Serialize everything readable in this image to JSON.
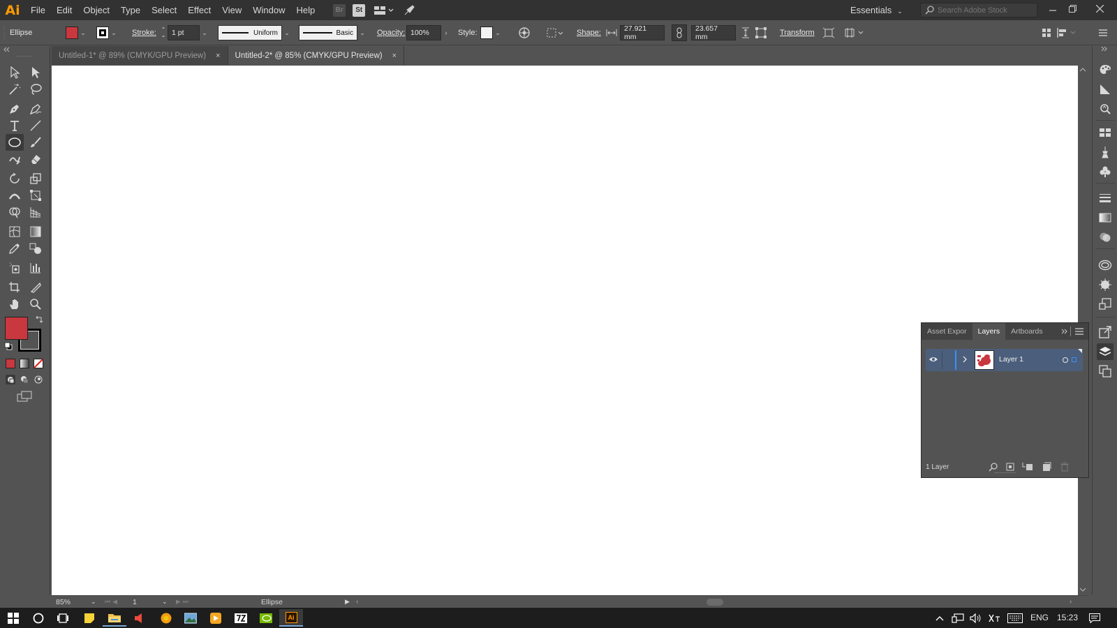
{
  "app": {
    "logo": "Ai",
    "menu": [
      "File",
      "Edit",
      "Object",
      "Type",
      "Select",
      "Effect",
      "View",
      "Window",
      "Help"
    ],
    "badges": {
      "bridge": "Br",
      "stock": "St"
    },
    "workspace": "Essentials",
    "search_placeholder": "Search Adobe Stock"
  },
  "control_bar": {
    "object_type": "Ellipse",
    "fill_color": "#c9373f",
    "stroke_label": "Stroke:",
    "stroke_weight": "1 pt",
    "profile": "Uniform",
    "brush": "Basic",
    "opacity_label": "Opacity:",
    "opacity": "100%",
    "style_label": "Style:",
    "shape_label": "Shape:",
    "width": "27.921 mm",
    "height": "23.657 mm",
    "transform_label": "Transform"
  },
  "tabs": [
    {
      "label": "Untitled-1* @ 89% (CMYK/GPU Preview)",
      "close": "×",
      "active": false
    },
    {
      "label": "Untitled-2* @ 85% (CMYK/GPU Preview)",
      "close": "×",
      "active": true
    }
  ],
  "toolbar": {
    "fill_color": "#c9373f",
    "stroke_color": "#000000"
  },
  "status_bar": {
    "zoom": "85%",
    "artboard": "1",
    "tool": "Ellipse"
  },
  "layers_panel": {
    "tabs": [
      "Asset Expor",
      "Layers",
      "Artboards"
    ],
    "active_tab": "Layers",
    "layer_name": "Layer 1",
    "footer": "1 Layer",
    "highlight_color": "#4b5f7c"
  },
  "taskbar": {
    "language": "ENG",
    "time": "15:23"
  }
}
